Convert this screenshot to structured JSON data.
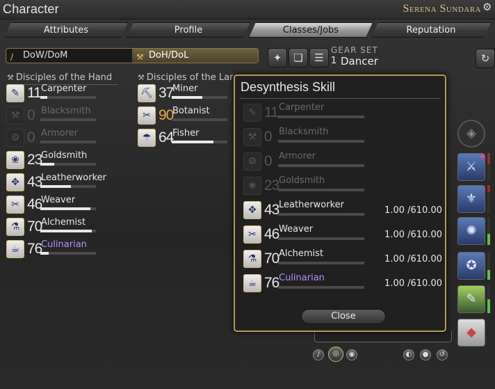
{
  "window": {
    "title": "Character",
    "character_name": "Serena Sundara"
  },
  "tabs": [
    {
      "label": "Attributes"
    },
    {
      "label": "Profile"
    },
    {
      "label": "Classes/Jobs"
    },
    {
      "label": "Reputation"
    }
  ],
  "categories": {
    "dow_dom": "DoW/DoM",
    "doh_dol": "DoH/DoL"
  },
  "gear_set": {
    "label": "GEAR SET",
    "number": "1",
    "job": "Dancer"
  },
  "sections": {
    "hand": "Disciples of the Hand",
    "land": "Disciples of the Lar"
  },
  "hand_jobs": [
    {
      "level": "11",
      "name": "Carpenter",
      "progress": 0.12
    },
    {
      "level": "0",
      "name": "Blacksmith",
      "progress": 0
    },
    {
      "level": "0",
      "name": "Armorer",
      "progress": 0
    },
    {
      "level": "23",
      "name": "Goldsmith",
      "progress": 0.25
    },
    {
      "level": "43",
      "name": "Leatherworker",
      "progress": 0.55
    },
    {
      "level": "46",
      "name": "Weaver",
      "progress": 0.9
    },
    {
      "level": "70",
      "name": "Alchemist",
      "progress": 0.92
    },
    {
      "level": "76",
      "name": "Culinarian",
      "progress": 0.15
    }
  ],
  "land_jobs": [
    {
      "level": "37",
      "name": "Miner",
      "progress": 0.55
    },
    {
      "level": "90",
      "name": "Botanist",
      "progress": 0
    },
    {
      "level": "64",
      "name": "Fisher",
      "progress": 0.75
    }
  ],
  "dialog": {
    "title": "Desynthesis Skill",
    "rows": [
      {
        "level": "11",
        "name": "Carpenter",
        "skill": ""
      },
      {
        "level": "0",
        "name": "Blacksmith",
        "skill": ""
      },
      {
        "level": "0",
        "name": "Armorer",
        "skill": ""
      },
      {
        "level": "23",
        "name": "Goldsmith",
        "skill": ""
      },
      {
        "level": "43",
        "name": "Leatherworker",
        "skill": "1.00 /610.00"
      },
      {
        "level": "46",
        "name": "Weaver",
        "skill": "1.00 /610.00"
      },
      {
        "level": "70",
        "name": "Alchemist",
        "skill": "1.00 /610.00"
      },
      {
        "level": "76",
        "name": "Culinarian",
        "skill": "1.00 /610.00"
      }
    ],
    "close_label": "Close"
  },
  "colors": {
    "accent_gold": "#b79a55",
    "max_level": "#e9a64a",
    "culinarian": "#b290ff"
  }
}
